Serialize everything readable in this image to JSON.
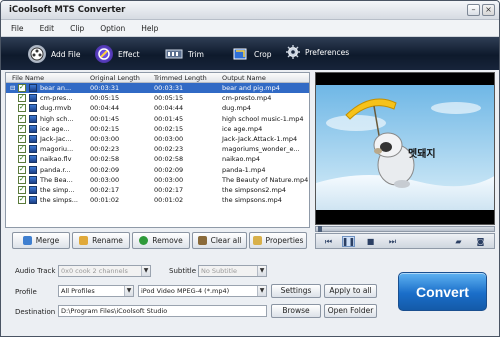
{
  "window": {
    "title": "iCoolsoft MTS Converter"
  },
  "menu": [
    "File",
    "Edit",
    "Clip",
    "Option",
    "Help"
  ],
  "toolbar": {
    "add_file": "Add File",
    "effect": "Effect",
    "trim": "Trim",
    "crop": "Crop",
    "preferences": "Preferences"
  },
  "filelist": {
    "columns": [
      "File Name",
      "Original Length",
      "Trimmed Length",
      "Output Name"
    ],
    "rows": [
      {
        "name": "bear an...",
        "orig": "00:03:31",
        "trim": "00:03:31",
        "out": "bear and pig.mp4"
      },
      {
        "name": "cm-pres...",
        "orig": "00:05:15",
        "trim": "00:05:15",
        "out": "cm-presto.mp4"
      },
      {
        "name": "dug.rmvb",
        "orig": "00:04:44",
        "trim": "00:04:44",
        "out": "dug.mp4"
      },
      {
        "name": "high sch...",
        "orig": "00:01:45",
        "trim": "00:01:45",
        "out": "high school music-1.mp4"
      },
      {
        "name": "ice age...",
        "orig": "00:02:15",
        "trim": "00:02:15",
        "out": "ice age.mp4"
      },
      {
        "name": "Jack-Jac...",
        "orig": "00:03:00",
        "trim": "00:03:00",
        "out": "Jack-Jack.Attack-1.mp4"
      },
      {
        "name": "magoriu...",
        "orig": "00:02:23",
        "trim": "00:02:23",
        "out": "magoriums_wonder_e..."
      },
      {
        "name": "naikao.flv",
        "orig": "00:02:58",
        "trim": "00:02:58",
        "out": "naikao.mp4"
      },
      {
        "name": "panda.r...",
        "orig": "00:02:09",
        "trim": "00:02:09",
        "out": "panda-1.mp4"
      },
      {
        "name": "The Bea...",
        "orig": "00:03:00",
        "trim": "00:03:00",
        "out": "The Beauty of Nature.mp4"
      },
      {
        "name": "the simp...",
        "orig": "00:02:17",
        "trim": "00:02:17",
        "out": "the simpsons2.mp4"
      },
      {
        "name": "the simps...",
        "orig": "00:01:02",
        "trim": "00:01:02",
        "out": "the simpsons.mp4"
      }
    ]
  },
  "list_buttons": {
    "merge": "Merge",
    "rename": "Rename",
    "remove": "Remove",
    "clear_all": "Clear all",
    "properties": "Properties"
  },
  "preview": {
    "caption": "멧돼지"
  },
  "settings": {
    "audio_track_label": "Audio Track",
    "audio_track_value": "0x0 cook 2 channels",
    "subtitle_label": "Subtitle",
    "subtitle_value": "No Subtitle",
    "profile_label": "Profile",
    "profile_category": "All Profiles",
    "profile_value": "iPod Video MPEG-4 (*.mp4)",
    "settings_button": "Settings",
    "apply_all_button": "Apply to all",
    "destination_label": "Destination",
    "destination_value": "D:\\Program Files\\iCoolsoft Studio",
    "browse_button": "Browse",
    "open_folder_button": "Open Folder",
    "convert_button": "Convert"
  },
  "colors": {
    "accent": "#1a6ec9",
    "selection": "#316ac5",
    "toolbar": "#0e1a2c"
  }
}
